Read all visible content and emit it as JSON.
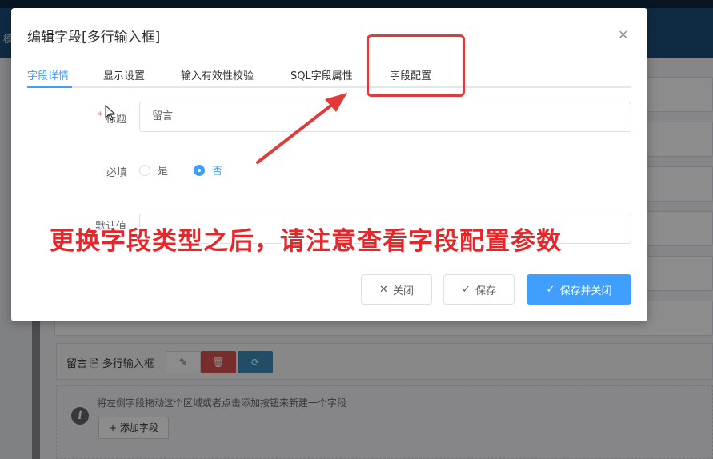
{
  "background": {
    "nav_char": "模",
    "field_row": {
      "name": "留言",
      "type": "多行输入框"
    },
    "hidden_row_text": "留言 · 多行输入框",
    "empty_hint": "将左侧字段拖动这个区域或者点击添加按钮来新建一个字段",
    "add_field_label": "+ 添加字段"
  },
  "dialog": {
    "title": "编辑字段[多行输入框]",
    "close_icon": "close-icon",
    "tabs": [
      {
        "label": "字段详情",
        "active": true
      },
      {
        "label": "显示设置",
        "active": false
      },
      {
        "label": "输入有效性校验",
        "active": false
      },
      {
        "label": "SQL字段属性",
        "active": false
      },
      {
        "label": "字段配置",
        "active": false
      }
    ],
    "form": {
      "title_label": "标题",
      "title_value": "留言",
      "required_label": "必填",
      "required_options": [
        {
          "label": "是",
          "checked": false
        },
        {
          "label": "否",
          "checked": true
        }
      ],
      "default_label": "默认值",
      "default_value": ""
    },
    "buttons": {
      "close": "关闭",
      "save": "保存",
      "save_close": "保存并关闭"
    }
  },
  "annotation": {
    "text": "更换字段类型之后，请注意查看字段配置参数",
    "color": "#e8262a"
  },
  "colors": {
    "primary": "#409eff",
    "nav": "#1d4f7a",
    "danger": "#d9534f"
  }
}
